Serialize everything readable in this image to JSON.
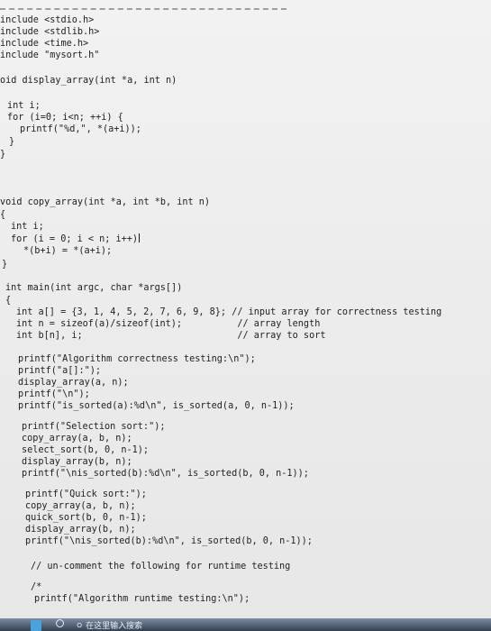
{
  "editor": {
    "lines": [
      "include <stdio.h>",
      "include <stdlib.h>",
      "include <time.h>",
      "include \"mysort.h\"",
      "oid display_array(int *a, int n)",
      "int i;",
      "for (i=0; i<n; ++i) {",
      "printf(\"%d,\", *(a+i));",
      "}",
      "}",
      "void copy_array(int *a, int *b, int n)",
      "{",
      "int i;",
      "for (i = 0; i < n; i++)",
      "*(b+i) = *(a+i);",
      "}",
      "int main(int argc, char *args[])",
      "{",
      "int a[] = {3, 1, 4, 5, 2, 7, 6, 9, 8}; // input array for correctness testing",
      "int n = sizeof(a)/sizeof(int);          // array length",
      "int b[n], i;                            // array to sort",
      "printf(\"Algorithm correctness testing:\\n\");",
      "printf(\"a[]:\");",
      "display_array(a, n);",
      "printf(\"\\n\");",
      "printf(\"is_sorted(a):%d\\n\", is_sorted(a, 0, n-1));",
      "printf(\"Selection sort:\");",
      "copy_array(a, b, n);",
      "select_sort(b, 0, n-1);",
      "display_array(b, n);",
      "printf(\"\\nis_sorted(b):%d\\n\", is_sorted(b, 0, n-1));",
      "printf(\"Quick sort:\");",
      "copy_array(a, b, n);",
      "quick_sort(b, 0, n-1);",
      "display_array(b, n);",
      "printf(\"\\nis_sorted(b):%d\\n\", is_sorted(b, 0, n-1));",
      "// un-comment the following for runtime testing",
      "/*",
      "printf(\"Algorithm runtime testing:\\n\");"
    ]
  },
  "taskbar": {
    "search_text": "ㅇ 在这里输入",
    "pinned_text": "搜索"
  }
}
